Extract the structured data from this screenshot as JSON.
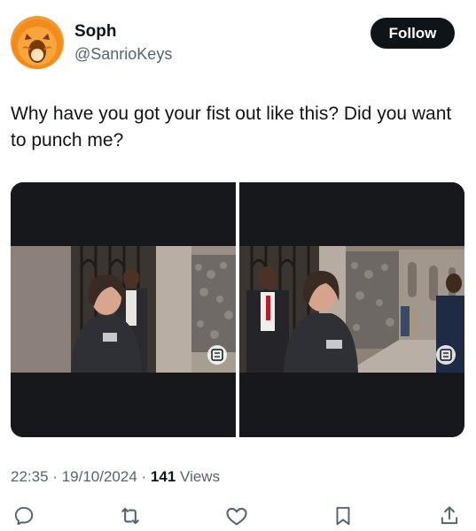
{
  "author": {
    "display_name": "Soph",
    "handle": "@SanrioKeys",
    "avatar_icon": "pumpkin-face-avatar"
  },
  "follow_button": {
    "label": "Follow"
  },
  "tweet": {
    "text": "Why have you got your fist out like this? Did you want to punch me?"
  },
  "media": {
    "photos": [
      {
        "icon": "image-options-icon"
      },
      {
        "icon": "image-options-icon"
      }
    ]
  },
  "meta": {
    "time": "22:35",
    "separator": "·",
    "date": "19/10/2024",
    "views_count": "141",
    "views_label": "Views"
  },
  "actions": [
    {
      "icon": "reply-icon"
    },
    {
      "icon": "retweet-icon"
    },
    {
      "icon": "like-icon"
    },
    {
      "icon": "bookmark-icon"
    },
    {
      "icon": "share-icon"
    }
  ],
  "colors": {
    "text_primary": "#0f1419",
    "text_secondary": "#536471",
    "follow_bg": "#0f1419",
    "letterbox": "#16181c",
    "avatar_orange": "#f28a1e"
  }
}
